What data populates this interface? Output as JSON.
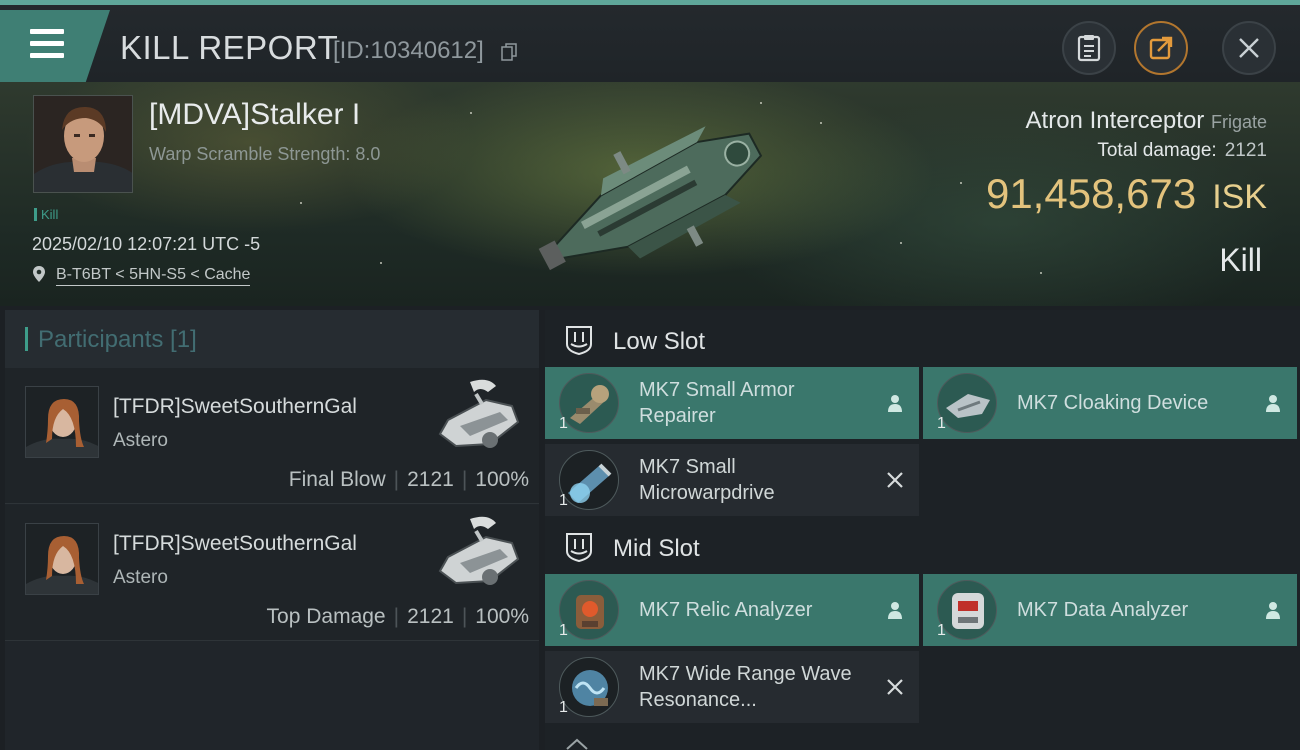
{
  "header": {
    "title": "KILL REPORT",
    "report_id": "[ID:10340612]",
    "icons": [
      "menu-icon",
      "copy-icon",
      "clipboard-icon",
      "share-icon",
      "close-icon"
    ]
  },
  "victim": {
    "pilot_name": "[MDVA]Stalker I",
    "warp_scramble": "Warp Scramble Strength: 8.0",
    "tag": "Kill",
    "datetime": "2025/02/10 12:07:21 UTC -5",
    "location": "B-T6BT < 5HN-S5 < Cache",
    "ship_name": "Atron Interceptor",
    "ship_class": "Frigate",
    "total_damage_label": "Total damage:",
    "total_damage": "2121",
    "isk_value": "91,458,673",
    "isk_unit": "ISK",
    "result": "Kill"
  },
  "participants": {
    "header": "Participants [1]",
    "rows": [
      {
        "name": "[TFDR]SweetSouthernGal",
        "ship": "Astero",
        "role": "Final Blow",
        "damage": "2121",
        "percent": "100%"
      },
      {
        "name": "[TFDR]SweetSouthernGal",
        "ship": "Astero",
        "role": "Top Damage",
        "damage": "2121",
        "percent": "100%"
      }
    ]
  },
  "slots": {
    "low": {
      "title": "Low Slot",
      "items": [
        {
          "name": "MK7 Small Armor Repairer",
          "qty": "1",
          "status": "person-icon",
          "active": true
        },
        {
          "name": "MK7 Cloaking Device",
          "qty": "1",
          "status": "person-icon",
          "active": true
        },
        {
          "name": "MK7 Small Microwarpdrive",
          "qty": "1",
          "status": "x-icon",
          "active": false
        }
      ]
    },
    "mid": {
      "title": "Mid Slot",
      "items": [
        {
          "name": "MK7 Relic Analyzer",
          "qty": "1",
          "status": "person-icon",
          "active": true
        },
        {
          "name": "MK7 Data Analyzer",
          "qty": "1",
          "status": "person-icon",
          "active": true
        },
        {
          "name": "MK7 Wide Range Wave Resonance...",
          "qty": "1",
          "status": "x-icon",
          "active": false
        }
      ]
    }
  },
  "colors": {
    "accent": "#3e9d8a",
    "active_item": "#3a776c",
    "isk": "#e3c37d",
    "background": "#1c2024"
  }
}
